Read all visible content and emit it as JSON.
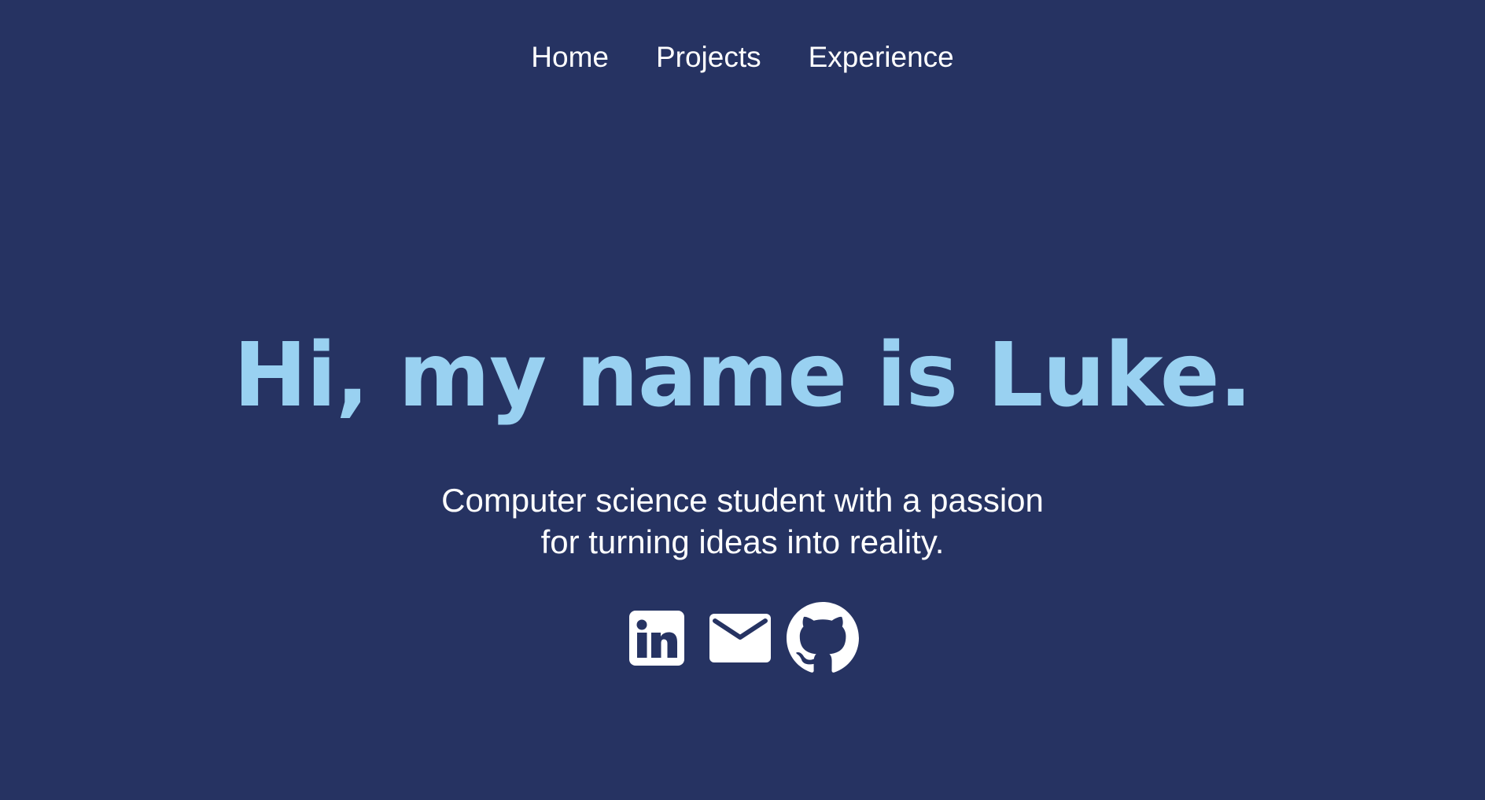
{
  "colors": {
    "background": "#263362",
    "accent": "#99d1f1",
    "text": "#ffffff"
  },
  "nav": {
    "items": [
      {
        "label": "Home"
      },
      {
        "label": "Projects"
      },
      {
        "label": "Experience"
      }
    ]
  },
  "hero": {
    "title": "Hi, my name is Luke.",
    "subtitle": "Computer science student with a passion for turning ideas into reality."
  },
  "social": {
    "icons": [
      "linkedin-icon",
      "mail-icon",
      "github-icon"
    ]
  }
}
